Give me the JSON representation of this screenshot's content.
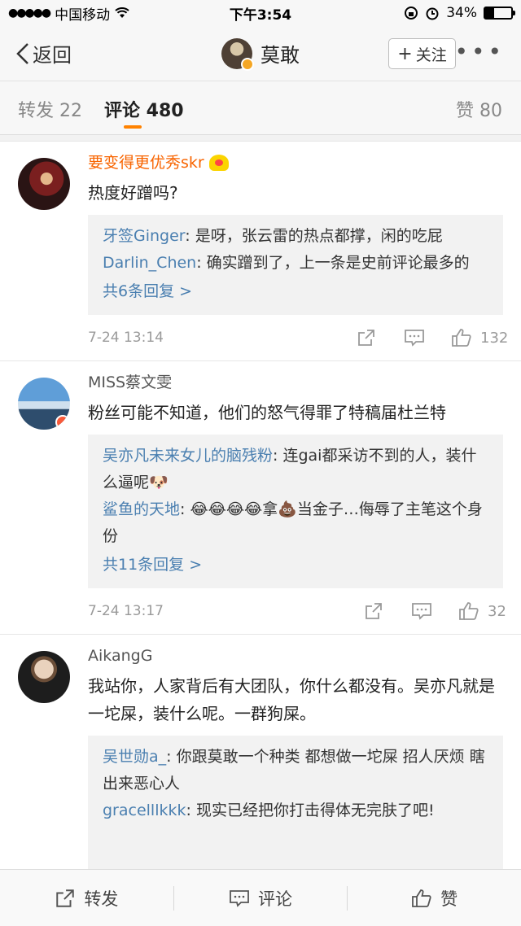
{
  "status_bar": {
    "carrier": "中国移动",
    "time": "下午3:54",
    "battery_pct": "34%",
    "battery_level": 0.34
  },
  "navbar": {
    "back_label": "返回",
    "title": "莫敢",
    "follow_label": "关注"
  },
  "tabs": [
    {
      "label": "转发 22"
    },
    {
      "label": "评论 480"
    },
    {
      "label": "赞 80"
    }
  ],
  "comments": [
    {
      "user": "要变得更优秀skr",
      "text": "热度好蹭吗?",
      "replies": [
        {
          "name": "牙签Ginger",
          "text": ": 是呀，张云雷的热点都撑，闲的吃屁"
        },
        {
          "name": "Darlin_Chen",
          "text": ": 确实蹭到了，上一条是史前评论最多的"
        }
      ],
      "more": "共6条回复 >",
      "date": "7-24 13:14",
      "likes": "132"
    },
    {
      "user": "MISS蔡文雯",
      "text": "粉丝可能不知道，他们的怒气得罪了特稿届杜兰特",
      "replies": [
        {
          "name": "吴亦凡未来女儿的脑残粉",
          "text": ": 连gai都采访不到的人，装什么逼呢🐶"
        },
        {
          "name": "鲨鱼的天地",
          "text": ": 😂😂😂😂拿💩当金子…侮辱了主笔这个身份"
        }
      ],
      "more": "共11条回复 >",
      "date": "7-24 13:17",
      "likes": "32"
    },
    {
      "user": "AikangG",
      "text": "我站你，人家背后有大团队，你什么都没有。吴亦凡就是一坨屎，装什么呢。一群狗屎。",
      "replies": [
        {
          "name": "吴世勋a_",
          "text": ": 你跟莫敢一个种类 都想做一坨屎 招人厌烦 瞎出来恶心人"
        },
        {
          "name": "gracelllkkk",
          "text": ": 现实已经把你打击得体无完肤了吧!"
        }
      ]
    }
  ],
  "bottom_bar": {
    "repost": "转发",
    "comment": "评论",
    "like": "赞"
  }
}
